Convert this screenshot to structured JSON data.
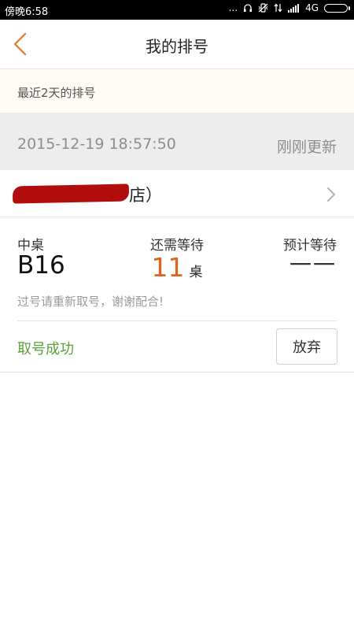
{
  "status_bar": {
    "time": "傍晚6:58",
    "dots": "...",
    "network": "4G"
  },
  "header": {
    "title": "我的排号"
  },
  "banner": {
    "text": "最近2天的排号"
  },
  "record": {
    "timestamp": "2015-12-19 18:57:50",
    "refresh_label": "刚刚更新",
    "shop_name_visible": "店）",
    "table_type_label": "中桌",
    "table_number": "B16",
    "wait_label": "还需等待",
    "wait_count": "11",
    "wait_unit": "桌",
    "estimate_label": "预计等待",
    "estimate_value": "一一",
    "notice": "过号请重新取号，谢谢配合!",
    "status": "取号成功",
    "abandon_label": "放弃"
  },
  "colors": {
    "accent": "#e2621b",
    "success": "#5aa23c",
    "redaction": "#b10d0d"
  }
}
